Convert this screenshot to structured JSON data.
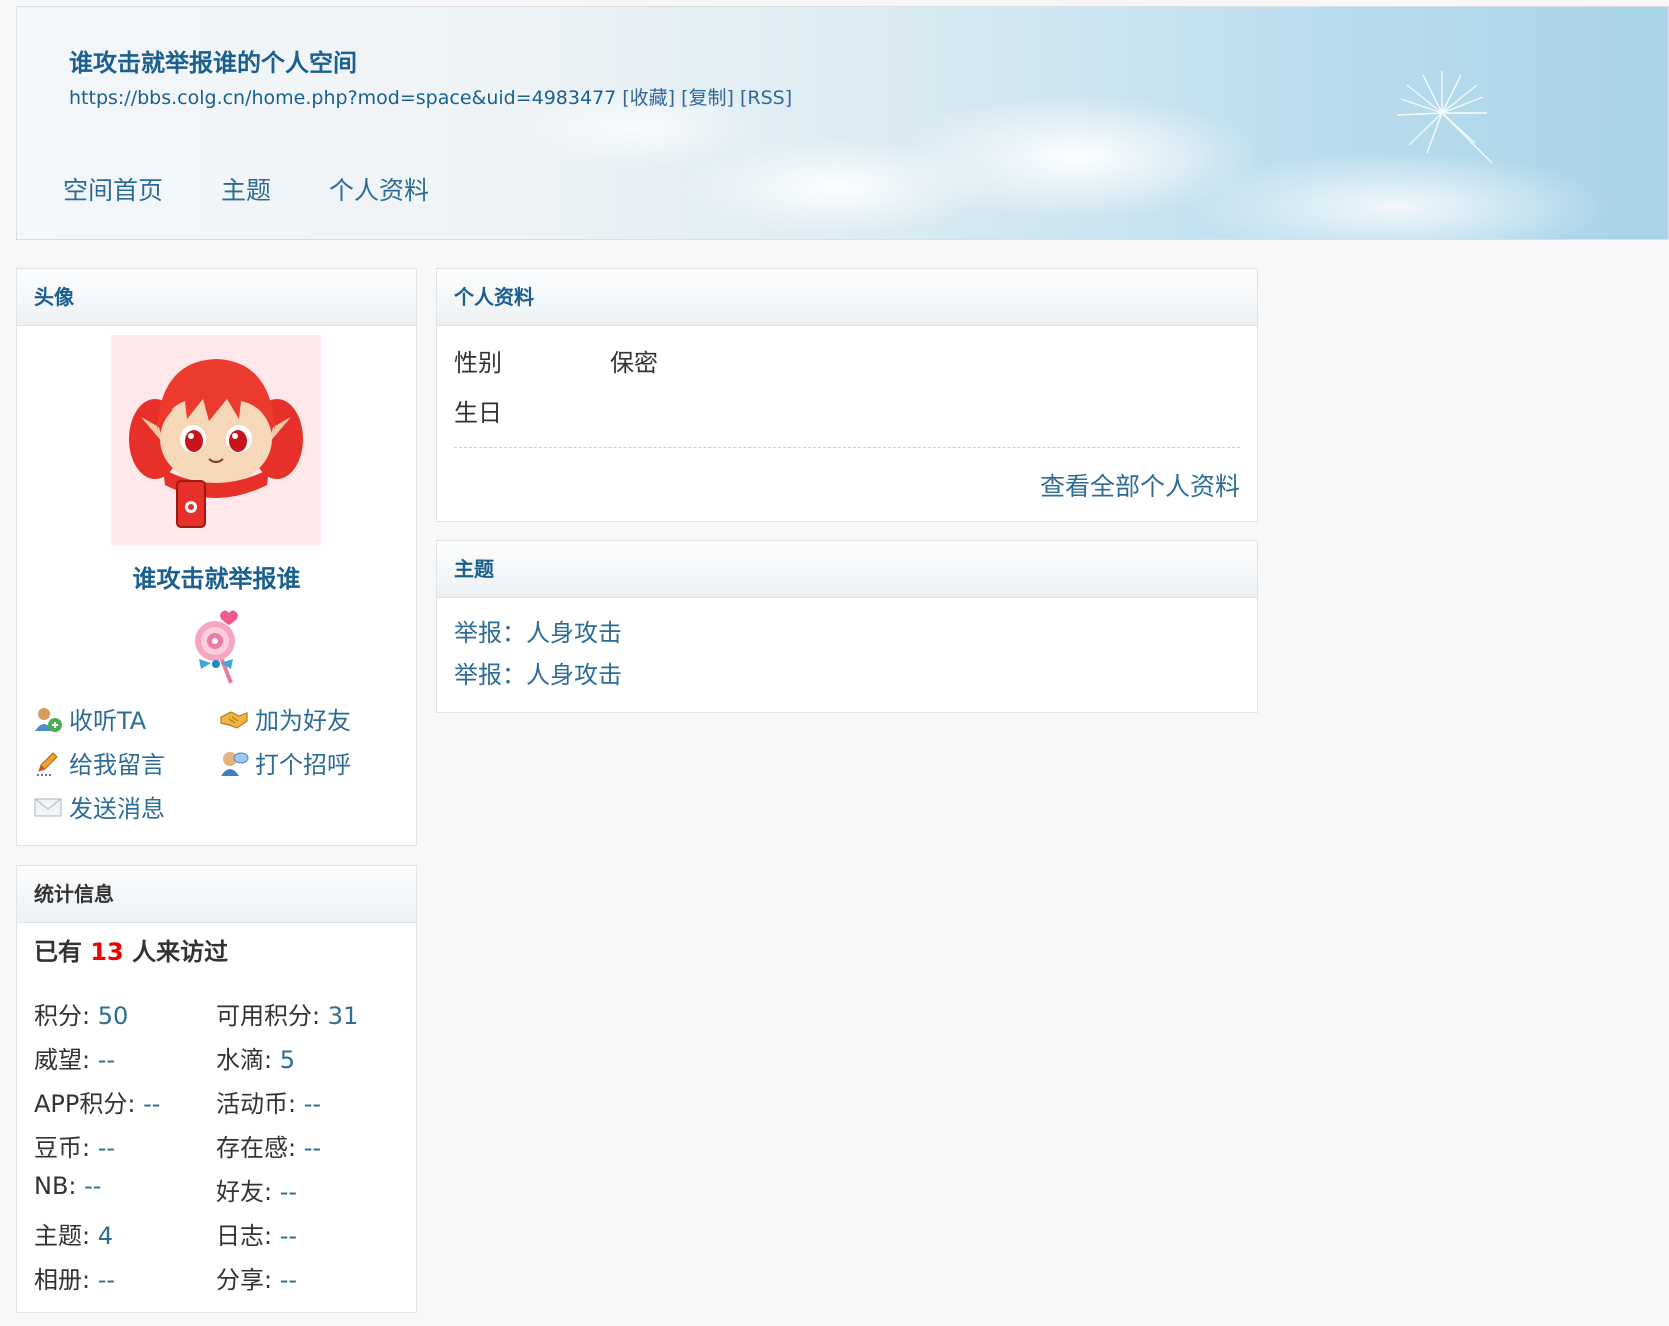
{
  "header": {
    "title": "谁攻击就举报谁的个人空间",
    "url": "https://bbs.colg.cn/home.php?mod=space&uid=4983477",
    "links": [
      "[收藏]",
      "[复制]",
      "[RSS]"
    ]
  },
  "nav": {
    "items": [
      "空间首页",
      "主题",
      "个人资料"
    ]
  },
  "avatar_panel": {
    "title": "头像",
    "username": "谁攻击就举报谁",
    "actions": [
      {
        "label": "收听TA",
        "icon": "follow-icon"
      },
      {
        "label": "加为好友",
        "icon": "handshake-icon"
      },
      {
        "label": "给我留言",
        "icon": "pencil-icon"
      },
      {
        "label": "打个招呼",
        "icon": "greet-icon"
      },
      {
        "label": "发送消息",
        "icon": "envelope-icon"
      }
    ]
  },
  "stats_panel": {
    "title": "统计信息",
    "visits_prefix": "已有",
    "visits_count": "13",
    "visits_suffix": "人来访过",
    "stats": [
      {
        "label": "积分: ",
        "value": "50"
      },
      {
        "label": "可用积分: ",
        "value": "31"
      },
      {
        "label": "威望: ",
        "value": "--"
      },
      {
        "label": "水滴: ",
        "value": "5"
      },
      {
        "label": "APP积分: ",
        "value": "--"
      },
      {
        "label": "活动币: ",
        "value": "--"
      },
      {
        "label": "豆币: ",
        "value": "--"
      },
      {
        "label": "存在感: ",
        "value": "--"
      },
      {
        "label": "NB: ",
        "value": "--"
      },
      {
        "label": "好友: ",
        "value": "--"
      },
      {
        "label": "主题: ",
        "value": "4"
      },
      {
        "label": "日志: ",
        "value": "--"
      },
      {
        "label": "相册: ",
        "value": "--"
      },
      {
        "label": "分享: ",
        "value": "--"
      }
    ]
  },
  "profile_panel": {
    "title": "个人资料",
    "rows": [
      {
        "label": "性别",
        "value": "保密"
      },
      {
        "label": "生日",
        "value": ""
      }
    ],
    "view_all": "查看全部个人资料"
  },
  "topics_panel": {
    "title": "主题",
    "items": [
      "举报：人身攻击",
      "举报：人身攻击"
    ]
  },
  "colors": {
    "link": "#2d6c95",
    "title": "#1a5f8f",
    "highlight": "#e00000"
  }
}
